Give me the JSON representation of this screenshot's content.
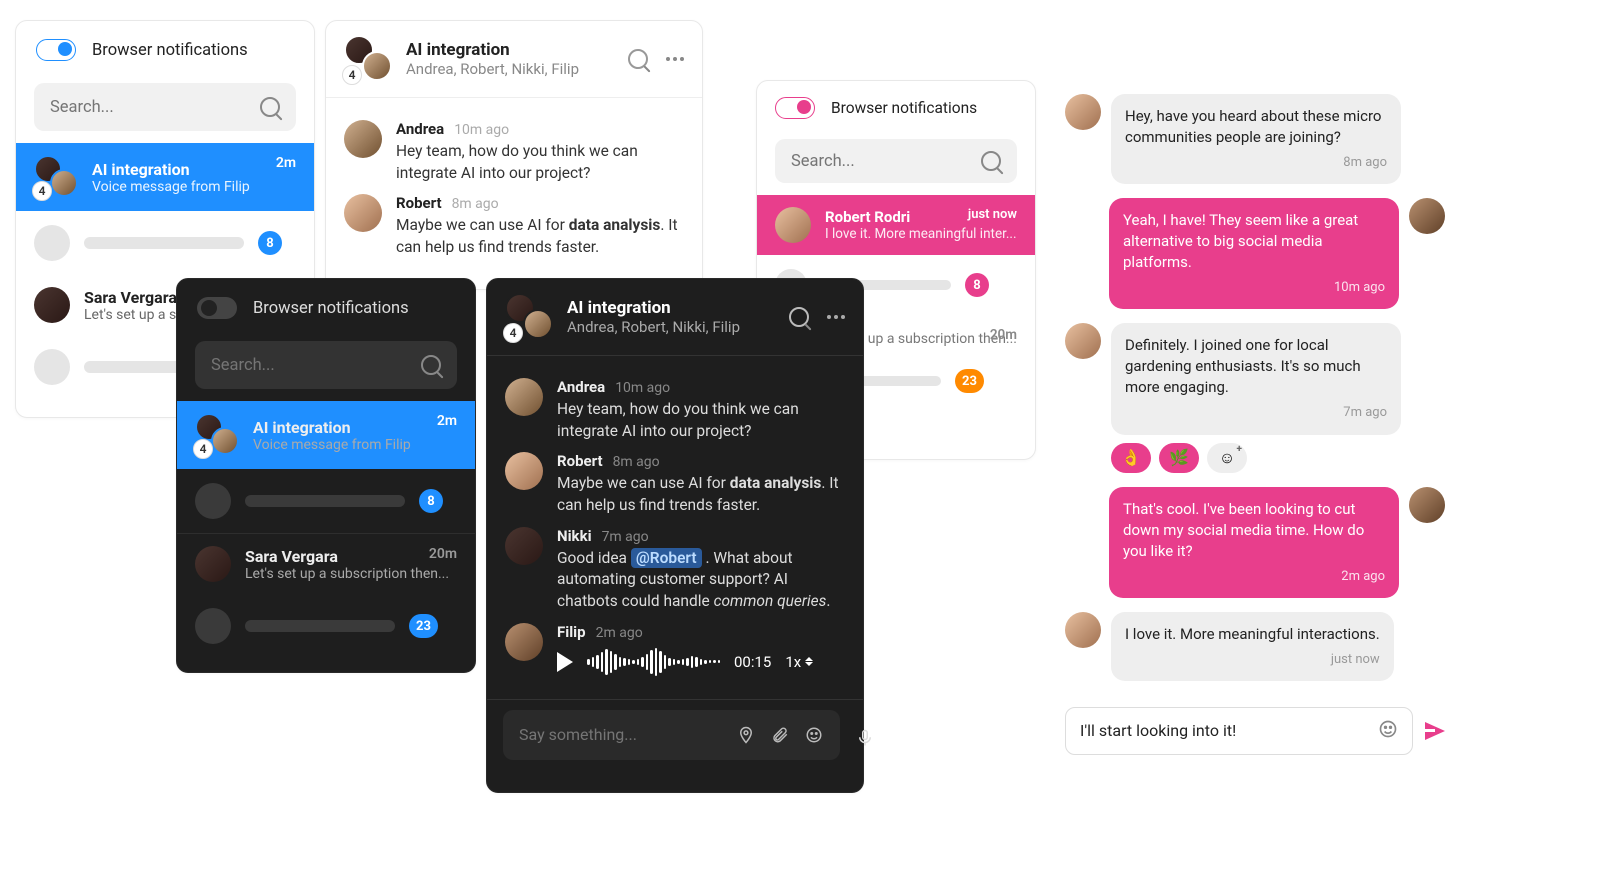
{
  "common": {
    "browser_notifications": "Browser notifications",
    "search_placeholder": "Search...",
    "group_count": "4"
  },
  "light_sidebar": {
    "conv_active": {
      "title": "AI integration",
      "sub": "Voice message from Filip",
      "time": "2m"
    },
    "badge1": "8",
    "conv2": {
      "title": "Sara Vergara",
      "sub": "Let's set up a su"
    }
  },
  "light_chat": {
    "title": "AI integration",
    "participants": "Andrea, Robert, Nikki, Filip",
    "m1": {
      "name": "Andrea",
      "time": "10m ago",
      "text": "Hey team, how do you think we can integrate AI into our project?"
    },
    "m2": {
      "name": "Robert",
      "time": "8m ago",
      "pre": "Maybe we can use AI for ",
      "b": "data analysis",
      "post": ". It can help us find trends faster."
    }
  },
  "dark_sidebar": {
    "conv_active": {
      "title": "AI integration",
      "sub": "Voice message from Filip",
      "time": "2m"
    },
    "badge1": "8",
    "conv2": {
      "title": "Sara Vergara",
      "sub": "Let's set up a subscription then...",
      "time": "20m"
    },
    "badge2": "23"
  },
  "dark_chat": {
    "title": "AI integration",
    "participants": "Andrea, Robert, Nikki, Filip",
    "m1": {
      "name": "Andrea",
      "time": "10m ago",
      "text": "Hey team, how do you think we can integrate AI into our project?"
    },
    "m2": {
      "name": "Robert",
      "time": "8m ago",
      "pre": "Maybe we can use AI for ",
      "b": "data analysis",
      "post": ". It can help us find trends faster."
    },
    "m3": {
      "name": "Nikki",
      "time": "7m ago",
      "pre": "Good idea ",
      "mention": "@Robert",
      "mid": " . What about automating customer support? AI chatbots could handle ",
      "i": "common queries",
      "post": "."
    },
    "m4": {
      "name": "Filip",
      "time": "2m ago",
      "dur": "00:15",
      "speed": "1x"
    },
    "composer_placeholder": "Say something..."
  },
  "pink_sidebar": {
    "conv_active": {
      "title": "Robert Rodri",
      "sub": "I love it. More meaningful inter...",
      "time": "just now"
    },
    "badge1": "8",
    "conv2_time": "20m",
    "conv2_sub": "up a subscription then...",
    "badge2": "23"
  },
  "bubble_chat": {
    "b1": {
      "text": "Hey, have you heard about these micro communities people are joining?",
      "ts": "8m ago"
    },
    "b2": {
      "text": "Yeah, I have! They seem like a great alternative to big social media platforms.",
      "ts": "10m ago"
    },
    "b3": {
      "text": "Definitely. I joined one for local gardening enthusiasts. It's so much more engaging.",
      "ts": "7m ago"
    },
    "r1": "👌",
    "r2": "🌿",
    "r3": "☺",
    "b4": {
      "text": "That's cool. I've been looking to cut down my social media time. How do you like it?",
      "ts": "2m ago"
    },
    "b5": {
      "text": "I love it. More meaningful interactions.",
      "ts": "just now"
    },
    "input": "I'll start looking into it!"
  }
}
